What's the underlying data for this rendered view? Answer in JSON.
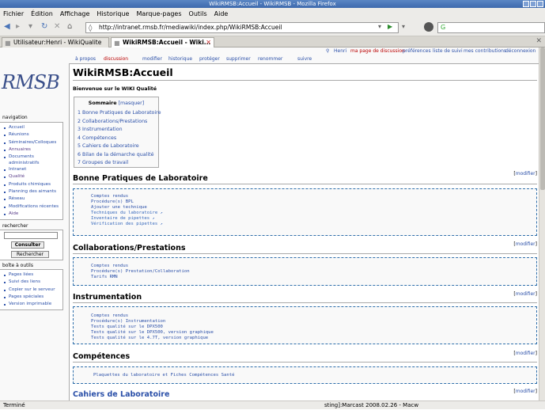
{
  "window_title": "WikiRMSB:Accueil - WikiRMSB - Mozilla Firefox",
  "menu": [
    "Fichier",
    "Édition",
    "Affichage",
    "Historique",
    "Marque-pages",
    "Outils",
    "Aide"
  ],
  "url": "http://intranet.rmsb.fr/mediawiki/index.php/WikiRMSB:Accueil",
  "search_engine": "G",
  "tabs": [
    {
      "label": "Utilisateur:Henri - WikiQualite",
      "active": false
    },
    {
      "label": "WikiRMSB:Accueil - Wiki...",
      "active": true
    }
  ],
  "personal_tools": [
    "Henri",
    "ma page de discussion",
    "préférences",
    "liste de suivi",
    "mes contributions",
    "déconnexion"
  ],
  "page_tabs": [
    "à propos",
    "discussion",
    "modifier",
    "historique",
    "protéger",
    "supprimer",
    "renommer",
    "suivre"
  ],
  "logo": {
    "text": "RMSB"
  },
  "navigation": {
    "title": "navigation",
    "items": [
      "Accueil",
      "Réunions",
      "Séminaires/Colloques",
      "Annuaires",
      "Documents administratifs",
      "Intranet",
      "Qualité",
      "Produits chimiques",
      "Planning des aimants",
      "Réseau",
      "Modifications récentes",
      "Aide"
    ]
  },
  "search_portlet": {
    "title": "rechercher",
    "consult_btn": "Consulter",
    "search_btn": "Rechercher"
  },
  "toolbox": {
    "title": "boîte à outils",
    "items": [
      "Pages liées",
      "Suivi des liens",
      "Copier sur le serveur",
      "Pages spéciales",
      "Version imprimable"
    ]
  },
  "content": {
    "title": "WikiRMSB:Accueil",
    "intro": "Bienvenue sur le WIKI Qualité",
    "toc": {
      "title": "Sommaire",
      "hide": "[masquer]",
      "items": [
        "1 Bonne Pratiques de Laboratoire",
        "2 Collaborations/Prestations",
        "3 Instrumentation",
        "4 Compétences",
        "5 Cahiers de Laboratoire",
        "6 Bilan de la démarche qualité",
        "7 Groupes de travail"
      ]
    },
    "edit_label": "modifier",
    "sections": [
      {
        "title": "Bonne Pratiques de Laboratoire",
        "lines": [
          "Comptes rendus",
          "Procédure(s) BPL",
          "Ajouter une technique",
          "Techniques du laboratoire",
          "Inventaire de pipettes",
          "Vérification des pipettes"
        ]
      },
      {
        "title": "Collaborations/Prestations",
        "lines": [
          "Comptes rendus",
          "Procédure(s) Prestation/Collaboration",
          "Tarifs RMN"
        ]
      },
      {
        "title": "Instrumentation",
        "lines": [
          "Comptes rendus",
          "Procédure(s) Instrumentation",
          "Tests qualité sur le DPX500",
          "Tests qualité sur le DPX500, version graphique",
          "Tests qualité sur le 4.7T, version graphique"
        ]
      },
      {
        "title": "Compétences",
        "lines": [
          "Plaquettes du laboratoire et Fiches Compétences Santé"
        ]
      },
      {
        "title": "Cahiers de Laboratoire",
        "lines": []
      }
    ]
  },
  "status": {
    "left": "Terminé",
    "taskbar": "sting]:Marcast 2008.02.26 - Macw"
  }
}
